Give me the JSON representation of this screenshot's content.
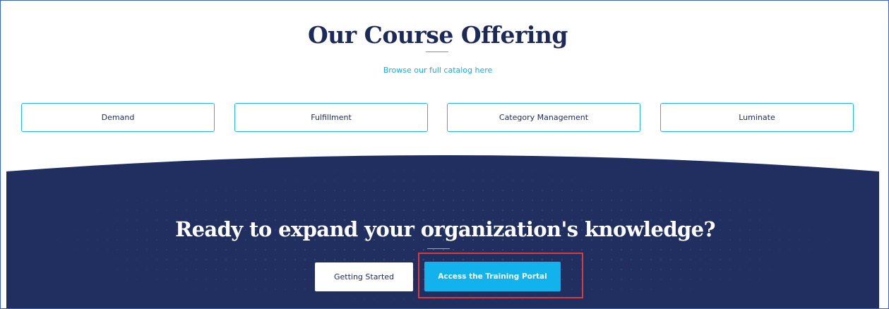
{
  "offerings": {
    "title": "Our Course Offering",
    "catalog_link": "Browse our full catalog here",
    "courses": [
      {
        "label": "Demand"
      },
      {
        "label": "Fulfillment"
      },
      {
        "label": "Category Management"
      },
      {
        "label": "Luminate"
      }
    ]
  },
  "cta": {
    "heading": "Ready to expand your organization's knowledge?",
    "getting_started_label": "Getting Started",
    "portal_label": "Access the Training Portal"
  },
  "colors": {
    "navy": "#1c2a5a",
    "band": "#202f5f",
    "accent": "#13aee6",
    "highlight": "#d93a3a"
  }
}
